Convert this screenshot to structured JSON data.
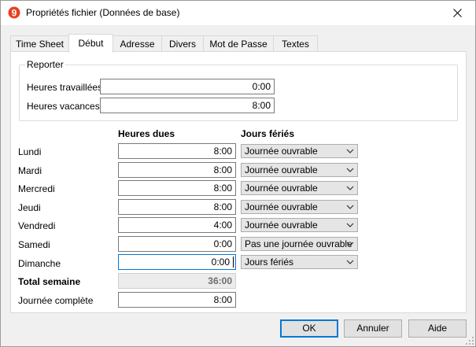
{
  "window": {
    "title": "Propriétés fichier (Données de base)"
  },
  "tabs": [
    {
      "label": "Time Sheet"
    },
    {
      "label": "Début"
    },
    {
      "label": "Adresse"
    },
    {
      "label": "Divers"
    },
    {
      "label": "Mot de Passe"
    },
    {
      "label": "Textes"
    }
  ],
  "active_tab": "Début",
  "reporter": {
    "legend": "Reporter",
    "worked_label": "Heures travaillées",
    "worked_value": "0:00",
    "vacation_label": "Heures vacances",
    "vacation_value": "8:00"
  },
  "schedule": {
    "col_hours": "Heures dues",
    "col_holidays": "Jours fériés",
    "days": [
      {
        "day": "Lundi",
        "hours": "8:00",
        "type": "Journée ouvrable"
      },
      {
        "day": "Mardi",
        "hours": "8:00",
        "type": "Journée ouvrable"
      },
      {
        "day": "Mercredi",
        "hours": "8:00",
        "type": "Journée ouvrable"
      },
      {
        "day": "Jeudi",
        "hours": "8:00",
        "type": "Journée ouvrable"
      },
      {
        "day": "Vendredi",
        "hours": "4:00",
        "type": "Journée ouvrable"
      },
      {
        "day": "Samedi",
        "hours": "0:00",
        "type": "Pas une journée ouvrable"
      },
      {
        "day": "Dimanche",
        "hours": "0:00",
        "type": "Jours fériés"
      }
    ],
    "total_label": "Total semaine",
    "total_value": "36:00",
    "fullday_label": "Journée complète",
    "fullday_value": "8:00"
  },
  "buttons": {
    "ok": "OK",
    "cancel": "Annuler",
    "help": "Aide"
  },
  "colors": {
    "accent": "#0078d7",
    "app_icon": "#e8411e"
  }
}
